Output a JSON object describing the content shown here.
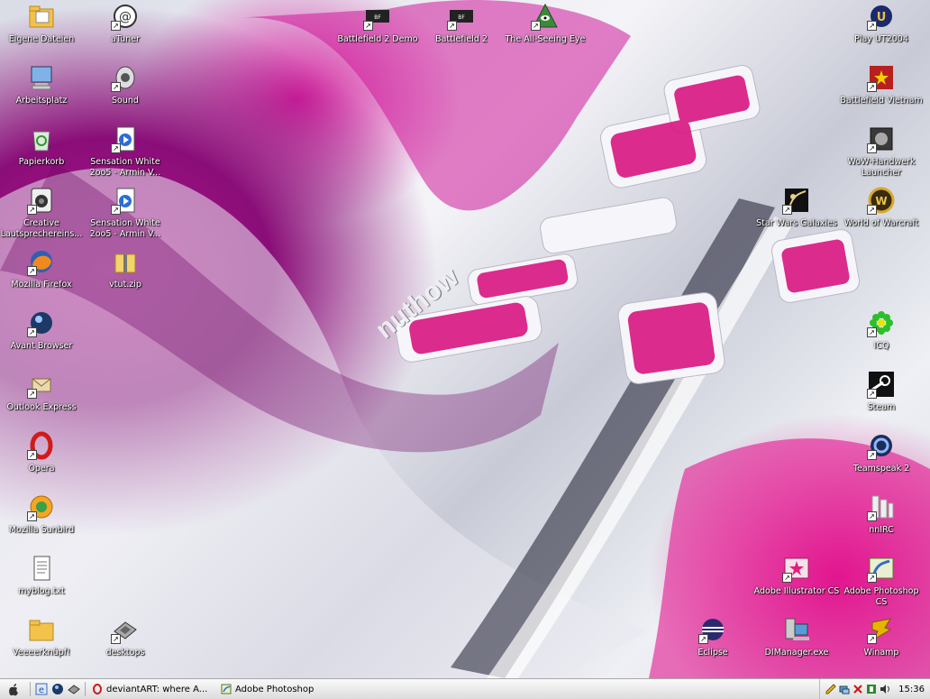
{
  "desktop_icons_left": [
    {
      "label": "Eigene Dateien",
      "icon": "folder-documents-icon"
    },
    {
      "label": "Arbeitsplatz",
      "icon": "computer-icon"
    },
    {
      "label": "Papierkorb",
      "icon": "recycle-bin-icon"
    },
    {
      "label": "Creative Lautsprechereins...",
      "icon": "speaker-icon"
    },
    {
      "label": "Mozilla Firefox",
      "icon": "firefox-icon"
    },
    {
      "label": "Avant Browser",
      "icon": "avant-browser-icon"
    },
    {
      "label": "Outlook Express",
      "icon": "outlook-express-icon"
    },
    {
      "label": "Opera",
      "icon": "opera-icon"
    },
    {
      "label": "Mozilla Sunbird",
      "icon": "sunbird-icon"
    },
    {
      "label": "myblog.txt",
      "icon": "text-file-icon"
    },
    {
      "label": "Veeeerknüpf!",
      "icon": "folder-icon"
    }
  ],
  "desktop_icons_left2": [
    {
      "label": "aTuner",
      "icon": "atuner-icon"
    },
    {
      "label": "Sound",
      "icon": "sound-icon"
    },
    {
      "label": "Sensation White 2oo5 - Armin V...",
      "icon": "media-file-icon"
    },
    {
      "label": "Sensation White 2oo5 - Armin V...",
      "icon": "media-file-icon"
    },
    {
      "label": "vtut.zip",
      "icon": "zip-icon"
    },
    {
      "label": "desktops",
      "icon": "desktops-icon"
    }
  ],
  "desktop_icons_top": [
    {
      "label": "Battlefield 2 Demo",
      "icon": "battlefield-icon"
    },
    {
      "label": "Battlefield 2",
      "icon": "battlefield-icon"
    },
    {
      "label": "The All-Seeing Eye",
      "icon": "all-seeing-eye-icon"
    }
  ],
  "desktop_icons_right": [
    {
      "label": "Play UT2004",
      "icon": "ut2004-icon"
    },
    {
      "label": "Battlefield Vietnam",
      "icon": "battlefield-vietnam-icon"
    },
    {
      "label": "WoW-Handwerk Launcher",
      "icon": "wow-launcher-icon"
    },
    {
      "label": "World of Warcraft",
      "icon": "world-of-warcraft-icon"
    },
    {
      "label": "ICQ",
      "icon": "icq-icon"
    },
    {
      "label": "Steam",
      "icon": "steam-icon"
    },
    {
      "label": "Teamspeak 2",
      "icon": "teamspeak-icon"
    },
    {
      "label": "nnIRC",
      "icon": "irc-icon"
    },
    {
      "label": "Adobe Photoshop CS",
      "icon": "photoshop-icon"
    },
    {
      "label": "Winamp",
      "icon": "winamp-icon"
    }
  ],
  "desktop_icons_right2": [
    {
      "label": "Star Wars Galaxies",
      "icon": "star-wars-galaxies-icon"
    },
    {
      "label": "Adobe Illustrator CS",
      "icon": "illustrator-icon"
    },
    {
      "label": "DIManager.exe",
      "icon": "dimanager-icon"
    },
    {
      "label": "Eclipse",
      "icon": "eclipse-icon"
    }
  ],
  "wallpaper_text": "nuthow",
  "taskbar": {
    "tasks": [
      {
        "label": "deviantART: where A...",
        "icon": "opera-icon"
      },
      {
        "label": "Adobe Photoshop",
        "icon": "photoshop-icon"
      }
    ],
    "clock": "15:36"
  },
  "colors": {
    "accent_pink": "#e0208f",
    "accent_purple": "#8a0e78"
  }
}
